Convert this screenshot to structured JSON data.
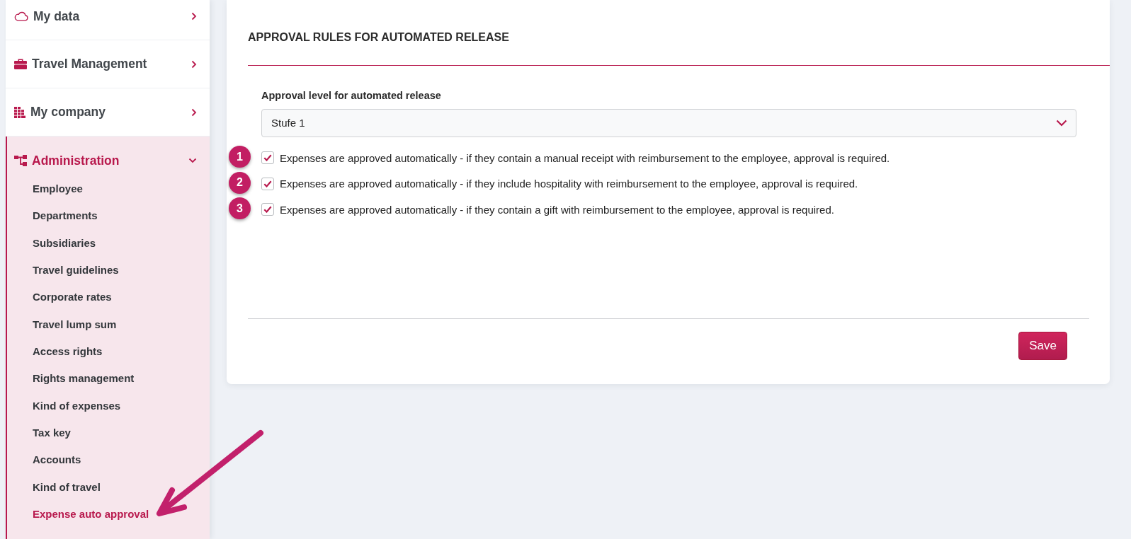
{
  "sidebar": {
    "items": [
      {
        "label": "My data",
        "expanded": false
      },
      {
        "label": "Travel Management",
        "expanded": false
      },
      {
        "label": "My company",
        "expanded": false
      },
      {
        "label": "Administration",
        "expanded": true,
        "children": [
          {
            "label": "Employee",
            "selected": false
          },
          {
            "label": "Departments",
            "selected": false
          },
          {
            "label": "Subsidiaries",
            "selected": false
          },
          {
            "label": "Travel guidelines",
            "selected": false
          },
          {
            "label": "Corporate rates",
            "selected": false
          },
          {
            "label": "Travel lump sum",
            "selected": false
          },
          {
            "label": "Access rights",
            "selected": false
          },
          {
            "label": "Rights management",
            "selected": false
          },
          {
            "label": "Kind of expenses",
            "selected": false
          },
          {
            "label": "Tax key",
            "selected": false
          },
          {
            "label": "Accounts",
            "selected": false
          },
          {
            "label": "Kind of travel",
            "selected": false
          },
          {
            "label": "Expense auto approval",
            "selected": true
          }
        ]
      }
    ]
  },
  "card": {
    "title": "APPROVAL RULES FOR AUTOMATED RELEASE",
    "approval_level": {
      "label": "Approval level for automated release",
      "value": "Stufe 1"
    },
    "rules": [
      {
        "marker": "1",
        "checked": true,
        "label": "Expenses are approved automatically - if they contain a manual receipt with reimbursement to the employee, approval is required."
      },
      {
        "marker": "2",
        "checked": true,
        "label": "Expenses are approved automatically - if they include hospitality with reimbursement to the employee, approval is required."
      },
      {
        "marker": "3",
        "checked": true,
        "label": "Expenses are approved automatically - if they contain a gift with reimbursement to the employee, approval is required."
      }
    ],
    "buttons": [
      {
        "label": "Save"
      }
    ]
  }
}
